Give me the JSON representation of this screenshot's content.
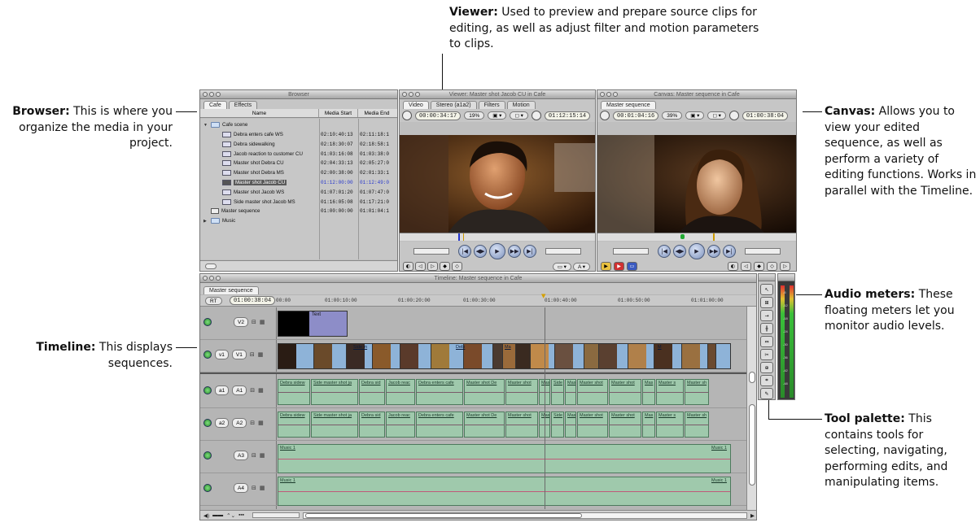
{
  "callouts": {
    "viewer": {
      "title": "Viewer:",
      "text": "Used to preview and prepare source clips for editing, as well as adjust filter and motion parameters to clips."
    },
    "browser": {
      "title": "Browser:",
      "text": "This is where you organize the media in your project."
    },
    "canvas": {
      "title": "Canvas:",
      "text": "Allows you to view your edited sequence, as well as perform a variety of editing functions. Works in parallel with the Timeline."
    },
    "audio_meters": {
      "title": "Audio meters:",
      "text": "These floating meters let you monitor audio levels."
    },
    "timeline": {
      "title": "Timeline:",
      "text": "This displays sequences."
    },
    "tool_palette": {
      "title": "Tool palette:",
      "text": "This contains tools for selecting, navigating, performing edits, and manipulating items."
    }
  },
  "browser": {
    "title": "Browser",
    "tabs": [
      "Cafe",
      "Effects"
    ],
    "columns": {
      "name": "Name",
      "start": "Media Start",
      "end": "Media End"
    },
    "rows": [
      {
        "name": "Cafe scene",
        "start": "",
        "end": "",
        "type": "folder-open",
        "indent": 0
      },
      {
        "name": "Debra enters cafe WS",
        "start": "02:10:40:13",
        "end": "02:11:18:1",
        "type": "clip",
        "indent": 1
      },
      {
        "name": "Debra sidewalking",
        "start": "02:18:30:07",
        "end": "02:18:58:1",
        "type": "clip",
        "indent": 1
      },
      {
        "name": "Jacob reaction to customer CU",
        "start": "01:03:16:08",
        "end": "01:03:38:0",
        "type": "clip",
        "indent": 1
      },
      {
        "name": "Master shot Debra CU",
        "start": "02:04:33:13",
        "end": "02:05:27:0",
        "type": "clip",
        "indent": 1
      },
      {
        "name": "Master shot Debra MS",
        "start": "02:00:38:00",
        "end": "02:01:33:1",
        "type": "clip",
        "indent": 1
      },
      {
        "name": "Master shot Jacob CU",
        "start": "01:12:00:00",
        "end": "01:12:49:0",
        "type": "clip-selected",
        "indent": 1
      },
      {
        "name": "Master shot Jacob WS",
        "start": "01:07:01:20",
        "end": "01:07:47:0",
        "type": "clip",
        "indent": 1
      },
      {
        "name": "Side master shot Jacob MS",
        "start": "01:16:05:08",
        "end": "01:17:21:0",
        "type": "clip",
        "indent": 1
      },
      {
        "name": "Master sequence",
        "start": "01:00:00:00",
        "end": "01:01:04:1",
        "type": "sequence",
        "indent": 0
      },
      {
        "name": "Music",
        "start": "",
        "end": "",
        "type": "folder",
        "indent": 0
      }
    ]
  },
  "viewer": {
    "title": "Viewer: Master shot Jacob CU in Cafe",
    "tabs": [
      "Video",
      "Stereo (a1a2)",
      "Filters",
      "Motion"
    ],
    "duration": "00:00:34:17",
    "zoom": "19%",
    "current_tc": "01:12:15:14"
  },
  "canvas": {
    "title": "Canvas: Master sequence in Cafe",
    "tab": "Master sequence",
    "duration": "00:01:04:16",
    "zoom": "39%",
    "current_tc": "01:00:38:04"
  },
  "timeline": {
    "title": "Timeline: Master sequence in Cafe",
    "tab": "Master sequence",
    "rt": "RT",
    "current_tc": "01:00:38:04",
    "ruler": [
      "00:00",
      "01:00:10:00",
      "01:00:20:00",
      "01:00:30:00",
      "01:00:40:00",
      "01:00:50:00",
      "01:01:00:00"
    ],
    "tracks": [
      {
        "src": "",
        "dst": "V2"
      },
      {
        "src": "v1",
        "dst": "V1"
      },
      {
        "src": "a1",
        "dst": "A1"
      },
      {
        "src": "a2",
        "dst": "A2"
      },
      {
        "src": "",
        "dst": "A3"
      },
      {
        "src": "",
        "dst": "A4"
      }
    ],
    "text_clip": "Text",
    "v1_labels": [
      "Side m",
      "Debi",
      "Ma",
      "M"
    ],
    "audio_clips": [
      "Debra sidew",
      "Side master shot ja",
      "Debra sid",
      "Jacob reac",
      "Debra enters cafe",
      "Master shot De",
      "Master shot",
      "Mas",
      "Side",
      "Mas",
      "Master shot",
      "Master shot",
      "Mas",
      "Master s",
      "Master sh"
    ],
    "music": "Music 1"
  },
  "meters": {
    "scale": [
      "-6",
      "-12",
      "-18",
      "-24",
      "-30",
      "-36",
      "-42",
      "-48"
    ]
  }
}
